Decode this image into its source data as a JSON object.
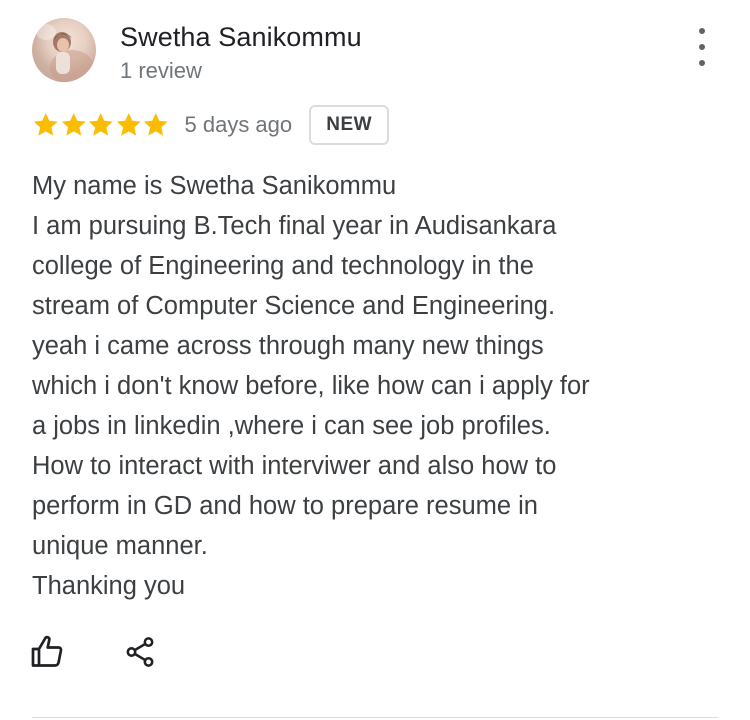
{
  "reviewer": {
    "name": "Swetha Sanikommu",
    "review_count": "1 review",
    "avatar_icon": "profile-photo"
  },
  "rating": {
    "stars": 5,
    "max_stars": 5,
    "star_color": "#fbbc04"
  },
  "date": "5 days ago",
  "badge": "NEW",
  "review_lines": [
    "My name is Swetha Sanikommu",
    "I am pursuing B.Tech final year in Audisankara",
    "college of Engineering and technology in the",
    "stream of Computer Science and Engineering.",
    "yeah i came across through many new things",
    "which i don't know before, like how can i apply for",
    "a jobs in linkedin ,where i can see job profiles.",
    "How to interact with interviwer and also how to",
    "perform in GD and how to prepare resume in",
    "unique manner.",
    "Thanking you"
  ],
  "actions": {
    "like_icon": "thumbs-up-icon",
    "share_icon": "share-icon",
    "more_icon": "more-vert-icon"
  }
}
